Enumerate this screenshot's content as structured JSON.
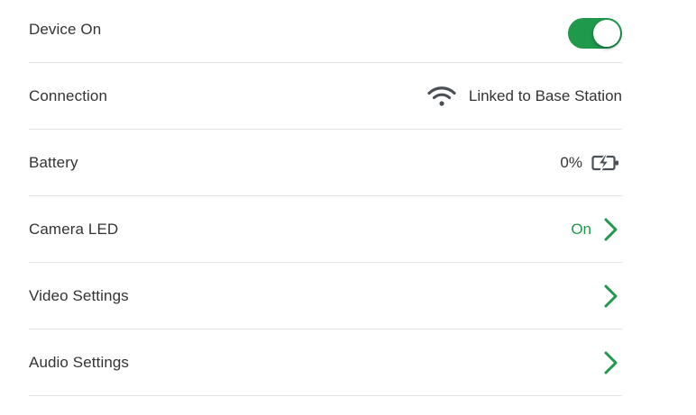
{
  "colors": {
    "accent": "#1f9a4c",
    "text": "#333333",
    "divider": "#e3e3e3",
    "icon": "#4a5055"
  },
  "settings": {
    "device_on": {
      "label": "Device On",
      "toggle": "on"
    },
    "connection": {
      "label": "Connection",
      "value": "Linked to Base Station",
      "icon": "wifi-icon"
    },
    "battery": {
      "label": "Battery",
      "value": "0%",
      "icon": "battery-charging-icon"
    },
    "camera_led": {
      "label": "Camera LED",
      "value": "On",
      "icon": "chevron-right-icon"
    },
    "video_settings": {
      "label": "Video Settings",
      "icon": "chevron-right-icon"
    },
    "audio_settings": {
      "label": "Audio Settings",
      "icon": "chevron-right-icon"
    }
  }
}
